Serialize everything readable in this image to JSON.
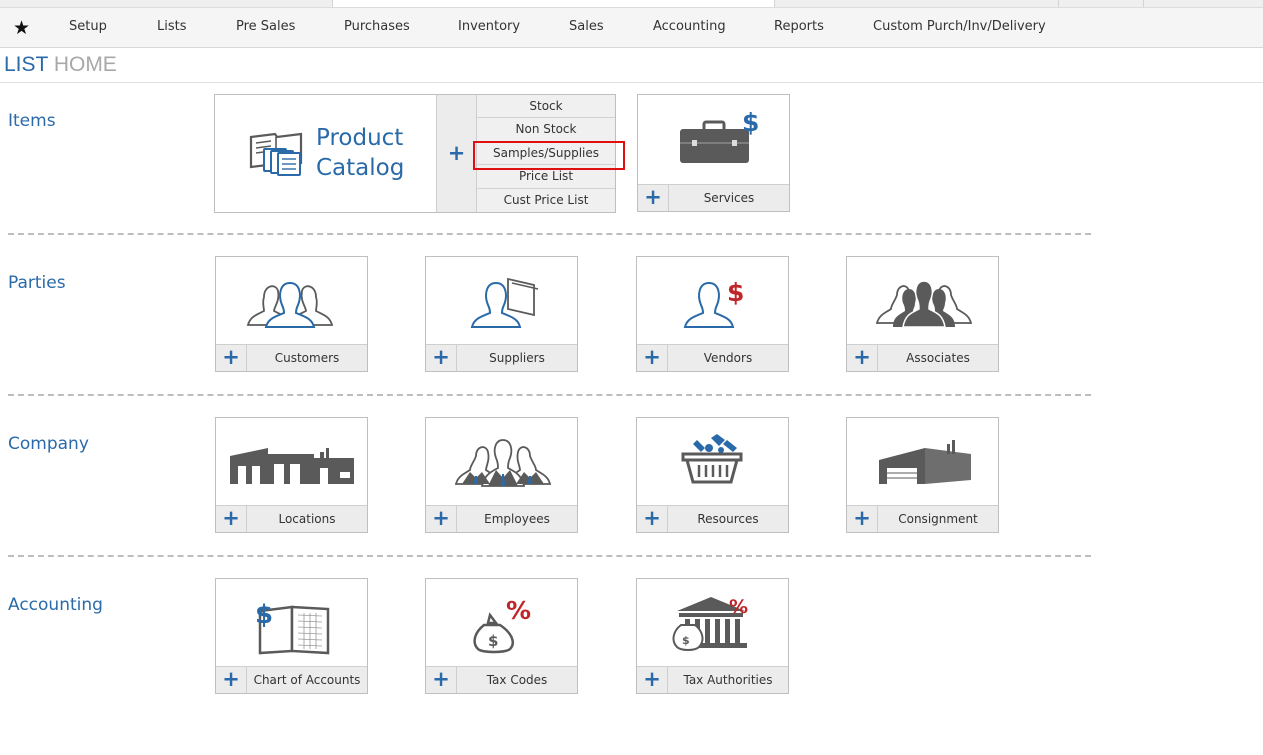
{
  "nav": {
    "items": [
      "Setup",
      "Lists",
      "Pre Sales",
      "Purchases",
      "Inventory",
      "Sales",
      "Accounting",
      "Reports",
      "Custom Purch/Inv/Delivery"
    ]
  },
  "heading": {
    "part1": "LIST",
    "part2": "HOME"
  },
  "sections": {
    "items": {
      "label": "Items",
      "catalog": {
        "title_line1": "Product",
        "title_line2": "Catalog",
        "plus": "+",
        "sub_items": [
          "Stock",
          "Non Stock",
          "Samples/Supplies",
          "Price List",
          "Cust Price List"
        ]
      },
      "services": "Services"
    },
    "parties": {
      "label": "Parties",
      "cards": [
        "Customers",
        "Suppliers",
        "Vendors",
        "Associates"
      ]
    },
    "company": {
      "label": "Company",
      "cards": [
        "Locations",
        "Employees",
        "Resources",
        "Consignment"
      ]
    },
    "accounting": {
      "label": "Accounting",
      "cards": [
        "Chart of Accounts",
        "Tax Codes",
        "Tax Authorities"
      ]
    }
  },
  "plus_symbol": "+",
  "colors": {
    "accent": "#2a6aa8",
    "icon_gray": "#5a5a5a",
    "money_red": "#c0252a",
    "highlight": "#e01010"
  }
}
